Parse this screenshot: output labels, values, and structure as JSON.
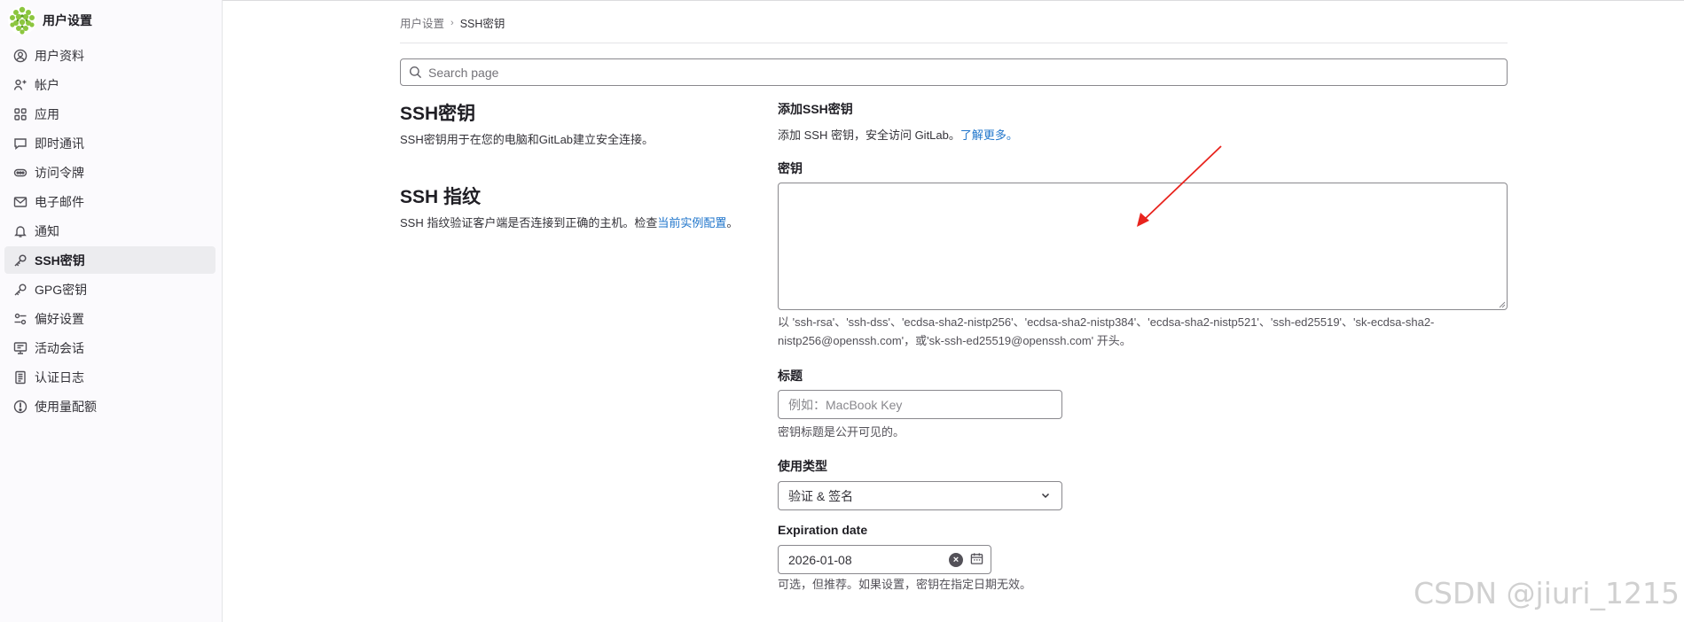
{
  "sidebar": {
    "title": "用户设置",
    "items": [
      {
        "label": "用户资料",
        "icon": "user-circle-icon"
      },
      {
        "label": "帐户",
        "icon": "account-icon"
      },
      {
        "label": "应用",
        "icon": "applications-icon"
      },
      {
        "label": "即时通讯",
        "icon": "chat-icon"
      },
      {
        "label": "访问令牌",
        "icon": "token-icon"
      },
      {
        "label": "电子邮件",
        "icon": "mail-icon"
      },
      {
        "label": "通知",
        "icon": "bell-icon"
      },
      {
        "label": "SSH密钥",
        "icon": "key-icon",
        "active": true
      },
      {
        "label": "GPG密钥",
        "icon": "key-icon"
      },
      {
        "label": "偏好设置",
        "icon": "preferences-icon"
      },
      {
        "label": "活动会话",
        "icon": "monitor-icon"
      },
      {
        "label": "认证日志",
        "icon": "log-icon"
      },
      {
        "label": "使用量配额",
        "icon": "quota-icon"
      }
    ]
  },
  "breadcrumb": {
    "parent": "用户设置",
    "current": "SSH密钥"
  },
  "search": {
    "placeholder": "Search page"
  },
  "ssh_keys_section": {
    "title": "SSH密钥",
    "description": "SSH密钥用于在您的电脑和GitLab建立安全连接。"
  },
  "fingerprint_section": {
    "title": "SSH 指纹",
    "description_prefix": "SSH 指纹验证客户端是否连接到正确的主机。检查",
    "link_text": "当前实例配置",
    "description_suffix": "。"
  },
  "add_key": {
    "heading": "添加SSH密钥",
    "intro": "添加 SSH 密钥，安全访问 GitLab。",
    "learn_more": "了解更多。",
    "key_label": "密钥",
    "key_value": "",
    "key_help": "以 'ssh-rsa'、'ssh-dss'、'ecdsa-sha2-nistp256'、'ecdsa-sha2-nistp384'、'ecdsa-sha2-nistp521'、'ssh-ed25519'、'sk-ecdsa-sha2-nistp256@openssh.com'，或'sk-ssh-ed25519@openssh.com' 开头。",
    "title_label": "标题",
    "title_placeholder": "例如：MacBook Key",
    "title_help": "密钥标题是公开可见的。",
    "usage_label": "使用类型",
    "usage_value": "验证 & 签名",
    "expiration_label": "Expiration date",
    "expiration_value": "2026-01-08",
    "expiration_help": "可选，但推荐。如果设置，密钥在指定日期无效。"
  },
  "watermark": "CSDN @jiuri_1215",
  "colors": {
    "link": "#1f75cb",
    "annotation_arrow": "#e8231d",
    "active_item_bg": "#ececef"
  }
}
